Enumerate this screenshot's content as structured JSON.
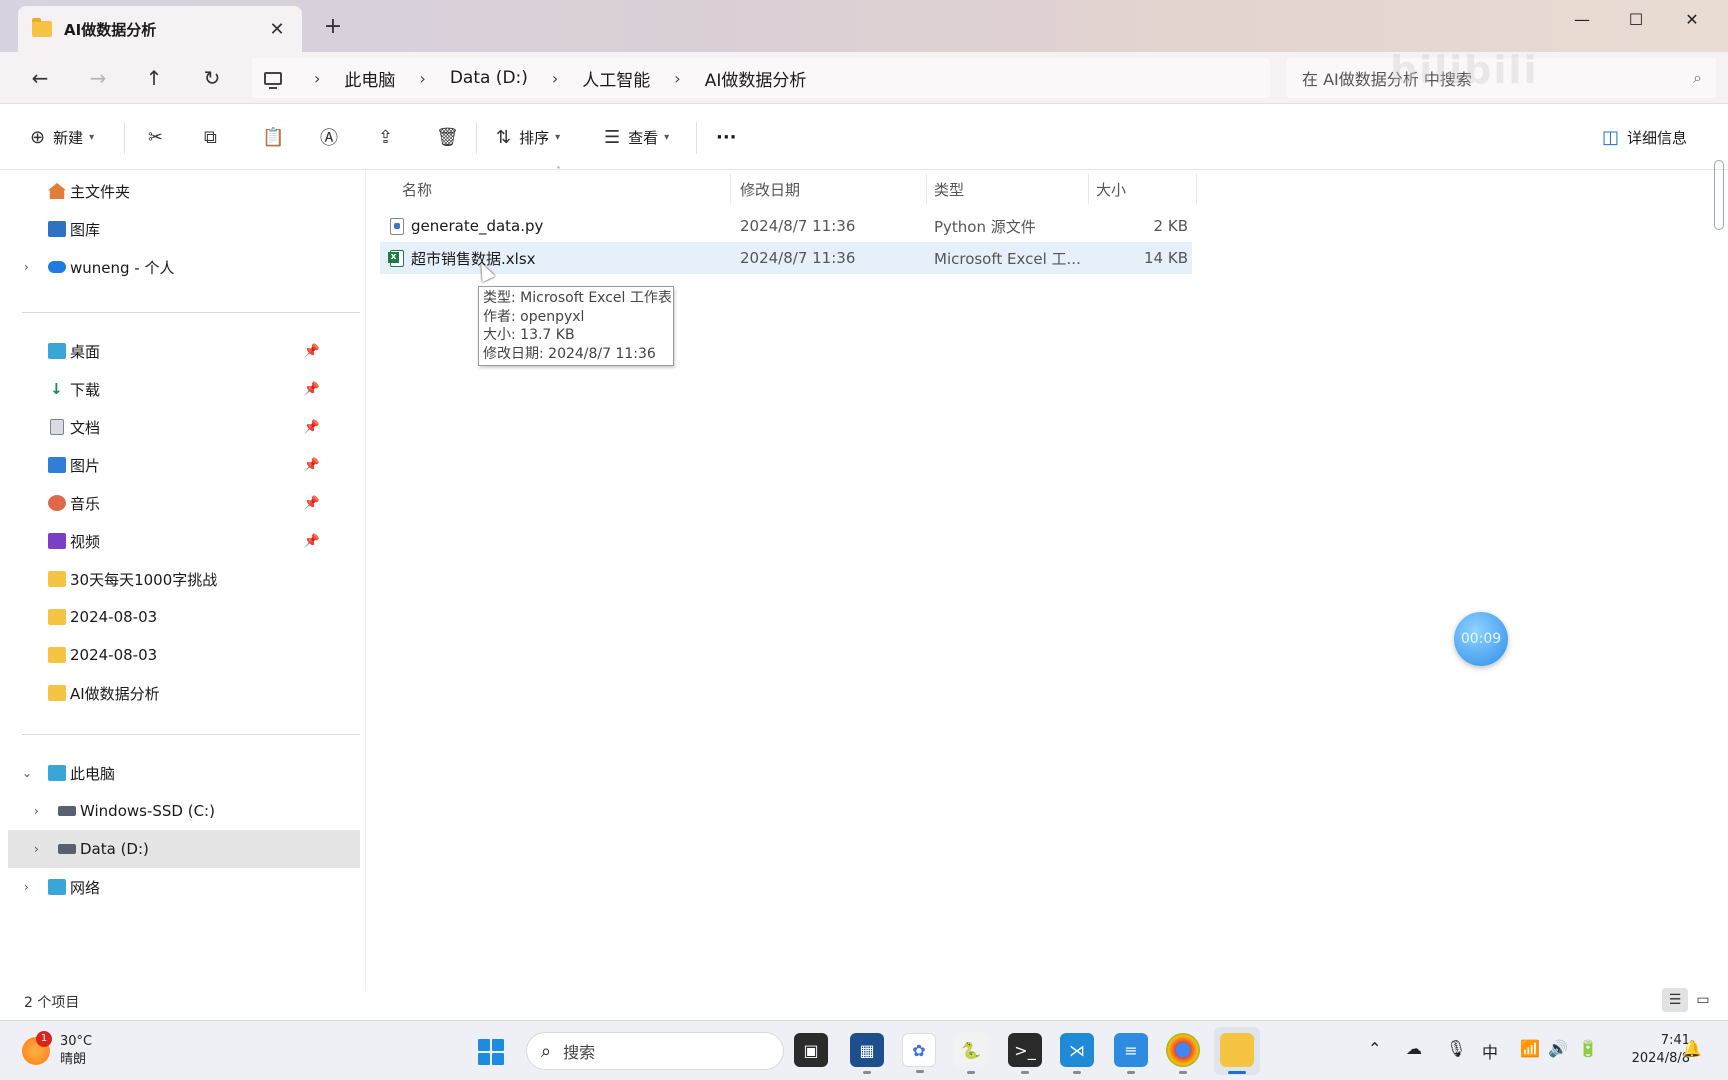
{
  "window": {
    "tab_title": "AI做数据分析",
    "tab_close": "✕",
    "new_tab": "+",
    "minimize": "—",
    "maximize": "☐",
    "close": "✕"
  },
  "address": {
    "crumbs": [
      "此电脑",
      "Data (D:)",
      "人工智能",
      "AI做数据分析"
    ],
    "search_placeholder": "在 AI做数据分析 中搜索"
  },
  "toolbar": {
    "new_label": "新建",
    "sort_label": "排序",
    "view_label": "查看",
    "more_label": "···",
    "details_label": "详细信息"
  },
  "sidebar": {
    "top_items": [
      {
        "label": "主文件夹",
        "icon": "home-icon"
      },
      {
        "label": "图库",
        "icon": "gallery-icon"
      },
      {
        "label": "wuneng - 个人",
        "icon": "onedrive-icon"
      }
    ],
    "pinned_items": [
      {
        "label": "桌面",
        "icon": "desktop-icon"
      },
      {
        "label": "下载",
        "icon": "download-icon"
      },
      {
        "label": "文档",
        "icon": "documents-icon"
      },
      {
        "label": "图片",
        "icon": "pictures-icon"
      },
      {
        "label": "音乐",
        "icon": "music-icon"
      },
      {
        "label": "视频",
        "icon": "videos-icon"
      },
      {
        "label": "30天每天1000字挑战",
        "icon": "folder-icon"
      },
      {
        "label": "2024-08-03",
        "icon": "folder-icon"
      },
      {
        "label": "2024-08-03",
        "icon": "folder-icon"
      },
      {
        "label": "AI做数据分析",
        "icon": "folder-icon"
      }
    ],
    "this_pc": "此电脑",
    "drive_c": "Windows-SSD (C:)",
    "drive_d": "Data (D:)",
    "network": "网络"
  },
  "columns": {
    "name": "名称",
    "date": "修改日期",
    "type": "类型",
    "size": "大小"
  },
  "files": [
    {
      "name": "generate_data.py",
      "date": "2024/8/7 11:36",
      "type": "Python 源文件",
      "size": "2 KB"
    },
    {
      "name": "超市销售数据.xlsx",
      "date": "2024/8/7 11:36",
      "type": "Microsoft Excel 工...",
      "size": "14 KB"
    }
  ],
  "tooltip": {
    "line1": "类型: Microsoft Excel 工作表",
    "line2": "作者: openpyxl",
    "line3": "大小: 13.7 KB",
    "line4": "修改日期: 2024/8/7 11:36"
  },
  "status": {
    "count": "2 个项目"
  },
  "overlay": {
    "timer": "00:09"
  },
  "taskbar": {
    "temperature": "30°C",
    "weather": "晴朗",
    "weather_badge": "1",
    "search_label": "搜索",
    "ime": "中",
    "time": "7:41",
    "date": "2024/8/8"
  },
  "colors": {
    "accent": "#1d6fd6",
    "folder": "#f5c443",
    "hover_row": "#e6f0fa"
  }
}
